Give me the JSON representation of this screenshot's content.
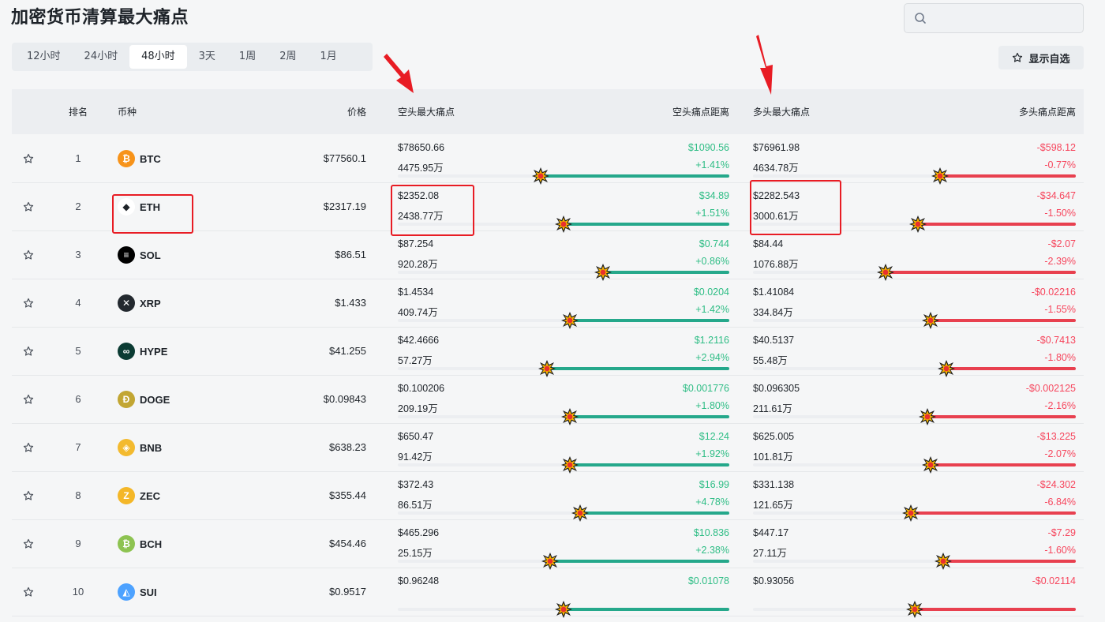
{
  "title": "加密货币清算最大痛点",
  "search": {
    "placeholder": ""
  },
  "tabs": [
    {
      "label": "12小时",
      "active": false
    },
    {
      "label": "24小时",
      "active": false
    },
    {
      "label": "48小时",
      "active": true
    },
    {
      "label": "3天",
      "active": false
    },
    {
      "label": "1周",
      "active": false
    },
    {
      "label": "2周",
      "active": false
    },
    {
      "label": "1月",
      "active": false
    }
  ],
  "favorites_label": "显示自选",
  "columns": {
    "rank": "排名",
    "coin": "币种",
    "price": "价格",
    "short_pain": "空头最大痛点",
    "short_dist": "空头痛点距离",
    "long_pain": "多头最大痛点",
    "long_dist": "多头痛点距离"
  },
  "colors": {
    "green": "#2ebd85",
    "red": "#f6465d",
    "annotation": "#e81c24"
  },
  "rows": [
    {
      "rank": "1",
      "symbol": "BTC",
      "icon": "bitcoin-icon",
      "icon_color": "#f7931a",
      "glyph": "₿",
      "price": "$77560.1",
      "short_price": "$78650.66",
      "short_vol": "4475.95万",
      "short_dist": "$1090.56",
      "short_pct": "+1.41%",
      "short_level": 0.57,
      "long_price": "$76961.98",
      "long_vol": "4634.78万",
      "long_dist": "-$598.12",
      "long_pct": "-0.77%",
      "long_level": 0.42
    },
    {
      "rank": "2",
      "symbol": "ETH",
      "icon": "ethereum-icon",
      "icon_color": "#ffffff",
      "glyph": "◆",
      "price": "$2317.19",
      "short_price": "$2352.08",
      "short_vol": "2438.77万",
      "short_dist": "$34.89",
      "short_pct": "+1.51%",
      "short_level": 0.5,
      "long_price": "$2282.543",
      "long_vol": "3000.61万",
      "long_dist": "-$34.647",
      "long_pct": "-1.50%",
      "long_level": 0.49
    },
    {
      "rank": "3",
      "symbol": "SOL",
      "icon": "solana-icon",
      "icon_color": "#000000",
      "glyph": "≡",
      "price": "$86.51",
      "short_price": "$87.254",
      "short_vol": "920.28万",
      "short_dist": "$0.744",
      "short_pct": "+0.86%",
      "short_level": 0.38,
      "long_price": "$84.44",
      "long_vol": "1076.88万",
      "long_dist": "-$2.07",
      "long_pct": "-2.39%",
      "long_level": 0.59
    },
    {
      "rank": "4",
      "symbol": "XRP",
      "icon": "xrp-icon",
      "icon_color": "#23292f",
      "glyph": "✕",
      "price": "$1.433",
      "short_price": "$1.4534",
      "short_vol": "409.74万",
      "short_dist": "$0.0204",
      "short_pct": "+1.42%",
      "short_level": 0.48,
      "long_price": "$1.41084",
      "long_vol": "334.84万",
      "long_dist": "-$0.02216",
      "long_pct": "-1.55%",
      "long_level": 0.45
    },
    {
      "rank": "5",
      "symbol": "HYPE",
      "icon": "hyperliquid-icon",
      "icon_color": "#0b3b33",
      "glyph": "∞",
      "price": "$41.255",
      "short_price": "$42.4666",
      "short_vol": "57.27万",
      "short_dist": "$1.2116",
      "short_pct": "+2.94%",
      "short_level": 0.55,
      "long_price": "$40.5137",
      "long_vol": "55.48万",
      "long_dist": "-$0.7413",
      "long_pct": "-1.80%",
      "long_level": 0.4
    },
    {
      "rank": "6",
      "symbol": "DOGE",
      "icon": "dogecoin-icon",
      "icon_color": "#c2a633",
      "glyph": "Ð",
      "price": "$0.09843",
      "short_price": "$0.100206",
      "short_vol": "209.19万",
      "short_dist": "$0.001776",
      "short_pct": "+1.80%",
      "short_level": 0.48,
      "long_price": "$0.096305",
      "long_vol": "211.61万",
      "long_dist": "-$0.002125",
      "long_pct": "-2.16%",
      "long_level": 0.46
    },
    {
      "rank": "7",
      "symbol": "BNB",
      "icon": "bnb-icon",
      "icon_color": "#f3ba2f",
      "glyph": "◈",
      "price": "$638.23",
      "short_price": "$650.47",
      "short_vol": "91.42万",
      "short_dist": "$12.24",
      "short_pct": "+1.92%",
      "short_level": 0.48,
      "long_price": "$625.005",
      "long_vol": "101.81万",
      "long_dist": "-$13.225",
      "long_pct": "-2.07%",
      "long_level": 0.45
    },
    {
      "rank": "8",
      "symbol": "ZEC",
      "icon": "zcash-icon",
      "icon_color": "#f4b728",
      "glyph": "Z",
      "price": "$355.44",
      "short_price": "$372.43",
      "short_vol": "86.51万",
      "short_dist": "$16.99",
      "short_pct": "+4.78%",
      "short_level": 0.45,
      "long_price": "$331.138",
      "long_vol": "121.65万",
      "long_dist": "-$24.302",
      "long_pct": "-6.84%",
      "long_level": 0.51
    },
    {
      "rank": "9",
      "symbol": "BCH",
      "icon": "bitcoin-cash-icon",
      "icon_color": "#8dc351",
      "glyph": "₿",
      "price": "$454.46",
      "short_price": "$465.296",
      "short_vol": "25.15万",
      "short_dist": "$10.836",
      "short_pct": "+2.38%",
      "short_level": 0.54,
      "long_price": "$447.17",
      "long_vol": "27.11万",
      "long_dist": "-$7.29",
      "long_pct": "-1.60%",
      "long_level": 0.41
    },
    {
      "rank": "10",
      "symbol": "SUI",
      "icon": "sui-icon",
      "icon_color": "#4da2ff",
      "glyph": "◭",
      "price": "$0.9517",
      "short_price": "$0.96248",
      "short_vol": "",
      "short_dist": "$0.01078",
      "short_pct": "",
      "short_level": 0.5,
      "long_price": "$0.93056",
      "long_vol": "",
      "long_dist": "-$0.02114",
      "long_pct": "",
      "long_level": 0.5
    }
  ]
}
